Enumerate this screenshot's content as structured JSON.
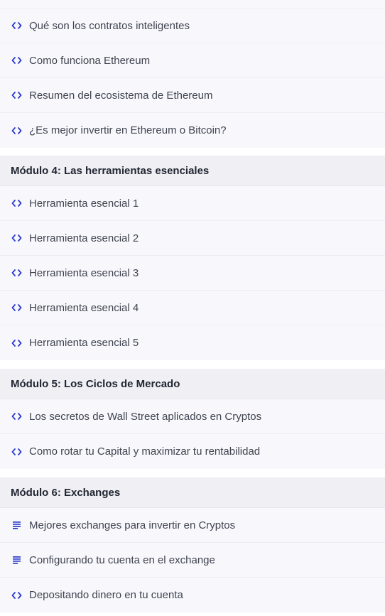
{
  "colors": {
    "module_header_bg": "#efeff4",
    "lesson_bg": "#f8f8fc",
    "icon_accent": "#2b3bcc",
    "gap_bg": "#ffffff"
  },
  "groups": [
    {
      "module": null,
      "lessons": [
        {
          "icon": "code-icon",
          "label": "Qué son los contratos inteligentes"
        },
        {
          "icon": "code-icon",
          "label": "Como funciona Ethereum"
        },
        {
          "icon": "code-icon",
          "label": "Resumen del ecosistema de Ethereum"
        },
        {
          "icon": "code-icon",
          "label": "¿Es mejor invertir en Ethereum o Bitcoin?"
        }
      ]
    },
    {
      "module": "Módulo 4: Las herramientas esenciales",
      "lessons": [
        {
          "icon": "code-icon",
          "label": "Herramienta esencial 1"
        },
        {
          "icon": "code-icon",
          "label": "Herramienta esencial 2"
        },
        {
          "icon": "code-icon",
          "label": "Herramienta esencial 3"
        },
        {
          "icon": "code-icon",
          "label": "Herramienta esencial 4"
        },
        {
          "icon": "code-icon",
          "label": "Herramienta esencial 5"
        }
      ]
    },
    {
      "module": "Módulo 5: Los Ciclos de Mercado",
      "lessons": [
        {
          "icon": "code-icon",
          "label": "Los secretos de Wall Street aplicados en Cryptos"
        },
        {
          "icon": "code-icon",
          "label": "Como rotar tu Capital y maximizar tu rentabilidad"
        }
      ]
    },
    {
      "module": "Módulo 6: Exchanges",
      "lessons": [
        {
          "icon": "text-lines-icon",
          "label": "Mejores exchanges para invertir en Cryptos"
        },
        {
          "icon": "text-lines-icon",
          "label": "Configurando tu cuenta en el exchange"
        },
        {
          "icon": "code-icon",
          "label": "Depositando dinero en tu cuenta"
        }
      ]
    }
  ]
}
